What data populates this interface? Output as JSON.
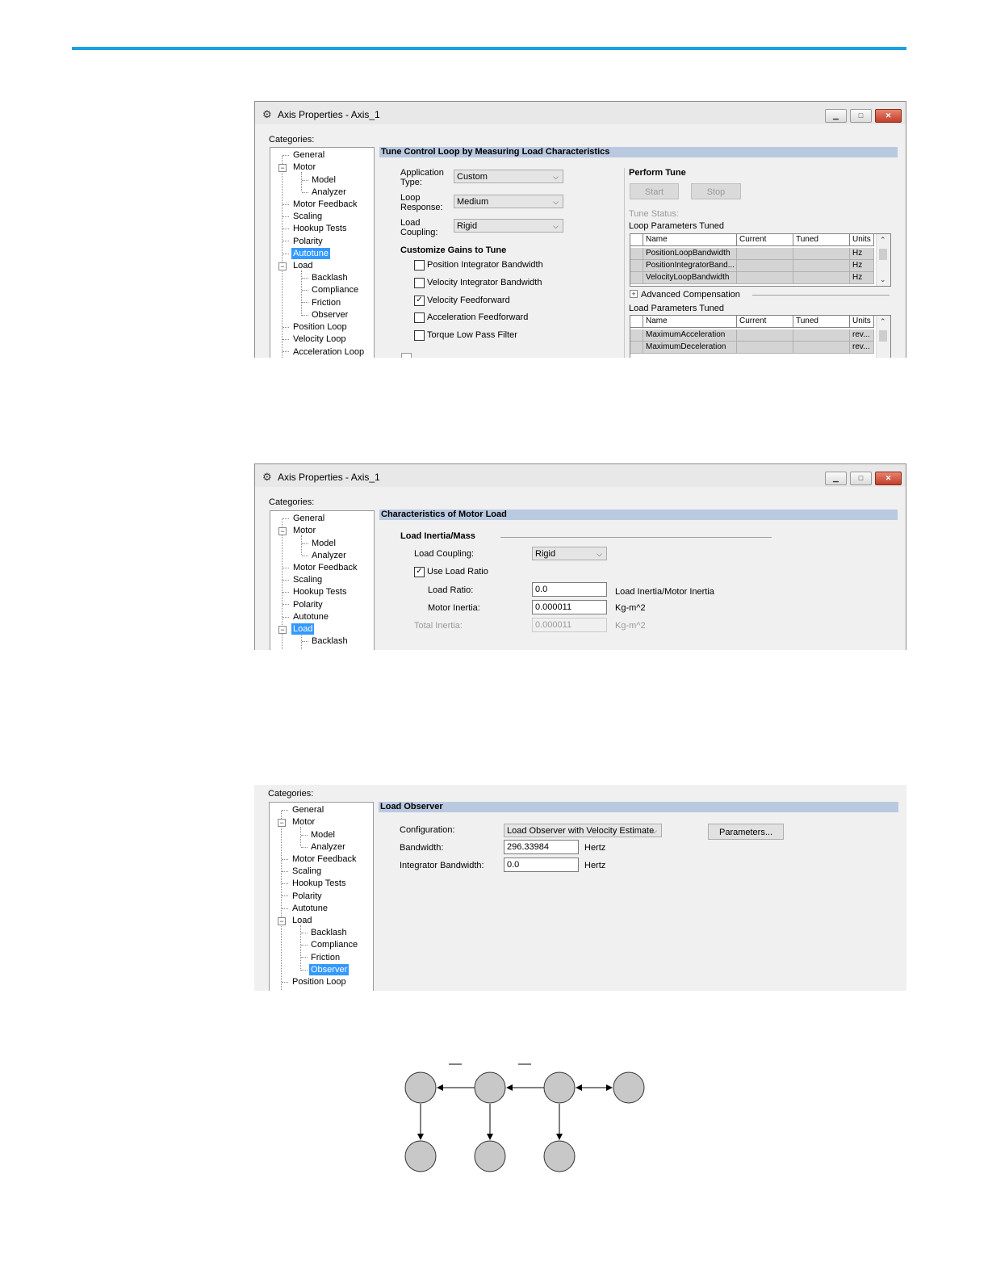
{
  "colors": {
    "accent_line": "#1ba1e2",
    "selection": "#3399ff",
    "section_header": "#b9c9e0",
    "diagram_node": "#c8c8c8"
  },
  "icons": {
    "app": "gear-icon",
    "minimize": "minimize-icon",
    "maximize": "maximize-icon",
    "close": "close-icon",
    "dropdown": "chevron-down-icon",
    "expander": "minus-box-icon",
    "plus": "plus-box-icon"
  },
  "screen1": {
    "window_title": "Axis Properties - Axis_1",
    "categories_label": "Categories:",
    "tree": [
      "General",
      "Motor",
      "Model",
      "Analyzer",
      "Motor Feedback",
      "Scaling",
      "Hookup Tests",
      "Polarity",
      "Autotune",
      "Load",
      "Backlash",
      "Compliance",
      "Friction",
      "Observer",
      "Position Loop",
      "Velocity Loop",
      "Acceleration Loop"
    ],
    "selected": "Autotune",
    "section_title": "Tune Control Loop by Measuring Load Characteristics",
    "application_type_label_1": "Application",
    "application_type_label_2": "Type:",
    "application_type_value": "Custom",
    "loop_response_label_1": "Loop",
    "loop_response_label_2": "Response:",
    "loop_response_value": "Medium",
    "load_coupling_label_1": "Load",
    "load_coupling_label_2": "Coupling:",
    "load_coupling_value": "Rigid",
    "customize_title": "Customize Gains to Tune",
    "gains": [
      {
        "label": "Position Integrator Bandwidth",
        "checked": false
      },
      {
        "label": "Velocity Integrator Bandwidth",
        "checked": false
      },
      {
        "label": "Velocity Feedforward",
        "checked": true
      },
      {
        "label": "Acceleration Feedforward",
        "checked": false
      },
      {
        "label": "Torque Low Pass Filter",
        "checked": false
      }
    ],
    "perform_tune_title": "Perform Tune",
    "start_label": "Start",
    "stop_label": "Stop",
    "tune_status_label": "Tune Status:",
    "loop_params_title": "Loop Parameters Tuned",
    "grid_headers": [
      "Name",
      "Current",
      "Tuned",
      "Units"
    ],
    "loop_params": [
      {
        "name": "PositionLoopBandwidth",
        "units": "Hz"
      },
      {
        "name": "PositionIntegratorBand...",
        "units": "Hz"
      },
      {
        "name": "VelocityLoopBandwidth",
        "units": "Hz"
      }
    ],
    "advanced_comp_label": "Advanced Compensation",
    "load_params_title": "Load Parameters Tuned",
    "load_params": [
      {
        "name": "MaximumAcceleration",
        "units": "rev..."
      },
      {
        "name": "MaximumDeceleration",
        "units": "rev..."
      }
    ]
  },
  "screen2": {
    "window_title": "Axis Properties - Axis_1",
    "categories_label": "Categories:",
    "tree": [
      "General",
      "Motor",
      "Model",
      "Analyzer",
      "Motor Feedback",
      "Scaling",
      "Hookup Tests",
      "Polarity",
      "Autotune",
      "Load",
      "Backlash"
    ],
    "selected": "Load",
    "section_title": "Characteristics of Motor Load",
    "group_title": "Load Inertia/Mass",
    "load_coupling_label": "Load Coupling:",
    "load_coupling_value": "Rigid",
    "use_load_ratio_label": "Use Load Ratio",
    "use_load_ratio_checked": true,
    "load_ratio_label": "Load Ratio:",
    "load_ratio_value": "0.0",
    "load_ratio_units": "Load Inertia/Motor Inertia",
    "motor_inertia_label": "Motor Inertia:",
    "motor_inertia_value": "0.000011",
    "motor_inertia_units": "Kg-m^2",
    "total_inertia_label": "Total Inertia:",
    "total_inertia_value": "0.000011",
    "total_inertia_units": "Kg-m^2"
  },
  "screen3": {
    "categories_label": "Categories:",
    "tree": [
      "General",
      "Motor",
      "Model",
      "Analyzer",
      "Motor Feedback",
      "Scaling",
      "Hookup Tests",
      "Polarity",
      "Autotune",
      "Load",
      "Backlash",
      "Compliance",
      "Friction",
      "Observer",
      "Position Loop"
    ],
    "selected": "Observer",
    "section_title": "Load Observer",
    "configuration_label": "Configuration:",
    "configuration_value": "Load Observer with Velocity Estimate",
    "parameters_button": "Parameters...",
    "bandwidth_label": "Bandwidth:",
    "bandwidth_value": "296.33984",
    "bandwidth_units": "Hertz",
    "integrator_bw_label": "Integrator Bandwidth:",
    "integrator_bw_value": "0.0",
    "integrator_bw_units": "Hertz"
  }
}
